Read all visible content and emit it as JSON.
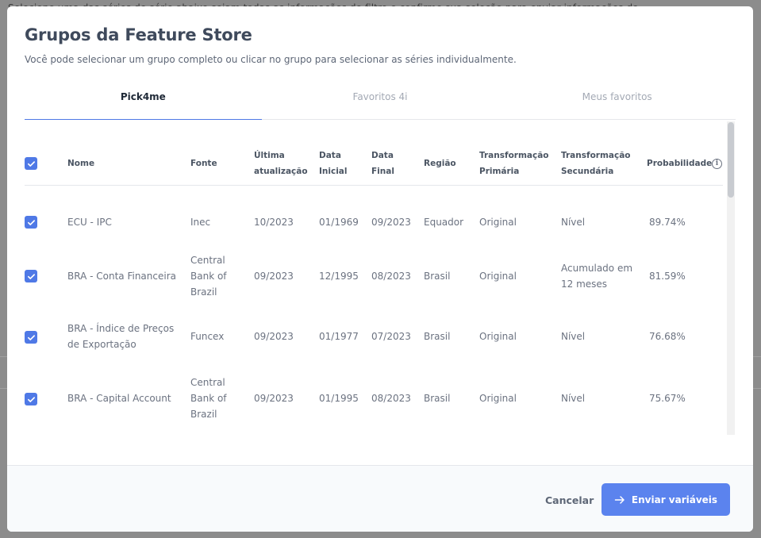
{
  "backdrop": {
    "text": "Selecione uma das séries de série abaixo sejam todas as informações do filtro e confirme sua seleção para enviar informações do"
  },
  "modal": {
    "title": "Grupos da Feature Store",
    "subtitle": "Você pode selecionar um grupo completo ou clicar no grupo para selecionar as séries individualmente."
  },
  "tabs": [
    {
      "label": "Pick4me",
      "active": true
    },
    {
      "label": "Favoritos 4i",
      "active": false
    },
    {
      "label": "Meus favoritos",
      "active": false
    }
  ],
  "table": {
    "headers": {
      "nome": "Nome",
      "fonte": "Fonte",
      "ultima_atualizacao": [
        "Última",
        "atualização"
      ],
      "data_inicial": [
        "Data",
        "Inicial"
      ],
      "data_final": [
        "Data",
        "Final"
      ],
      "regiao": "Região",
      "transformacao_primaria": [
        "Transformação",
        "Primária"
      ],
      "transformacao_secundaria": [
        "Transformação",
        "Secundária"
      ],
      "probabilidade": "Probabilidade"
    },
    "rows": [
      {
        "nome": [
          "ECU - IPC"
        ],
        "fonte": [
          "Inec"
        ],
        "ultima_atualizacao": "10/2023",
        "data_inicial": "01/1969",
        "data_final": "09/2023",
        "regiao": "Equador",
        "transformacao_primaria": "Original",
        "transformacao_secundaria": [
          "Nível"
        ],
        "probabilidade": "89.74%"
      },
      {
        "nome": [
          "BRA - Conta Financeira"
        ],
        "fonte": [
          "Central",
          "Bank of",
          "Brazil"
        ],
        "ultima_atualizacao": "09/2023",
        "data_inicial": "12/1995",
        "data_final": "08/2023",
        "regiao": "Brasil",
        "transformacao_primaria": "Original",
        "transformacao_secundaria": [
          "Acumulado em",
          "12 meses"
        ],
        "probabilidade": "81.59%"
      },
      {
        "nome": [
          "BRA - Índice de Preços",
          "de Exportação"
        ],
        "fonte": [
          "Funcex"
        ],
        "ultima_atualizacao": "09/2023",
        "data_inicial": "01/1977",
        "data_final": "07/2023",
        "regiao": "Brasil",
        "transformacao_primaria": "Original",
        "transformacao_secundaria": [
          "Nível"
        ],
        "probabilidade": "76.68%"
      },
      {
        "nome": [
          "BRA - Capital Account"
        ],
        "fonte": [
          "Central",
          "Bank of",
          "Brazil"
        ],
        "ultima_atualizacao": "09/2023",
        "data_inicial": "01/1995",
        "data_final": "08/2023",
        "regiao": "Brasil",
        "transformacao_primaria": "Original",
        "transformacao_secundaria": [
          "Nível"
        ],
        "probabilidade": "75.67%"
      }
    ]
  },
  "footer": {
    "cancel_label": "Cancelar",
    "send_label": "Enviar variáveis"
  },
  "colors": {
    "accent": "#4f79e6",
    "button": "#5b83ee"
  }
}
